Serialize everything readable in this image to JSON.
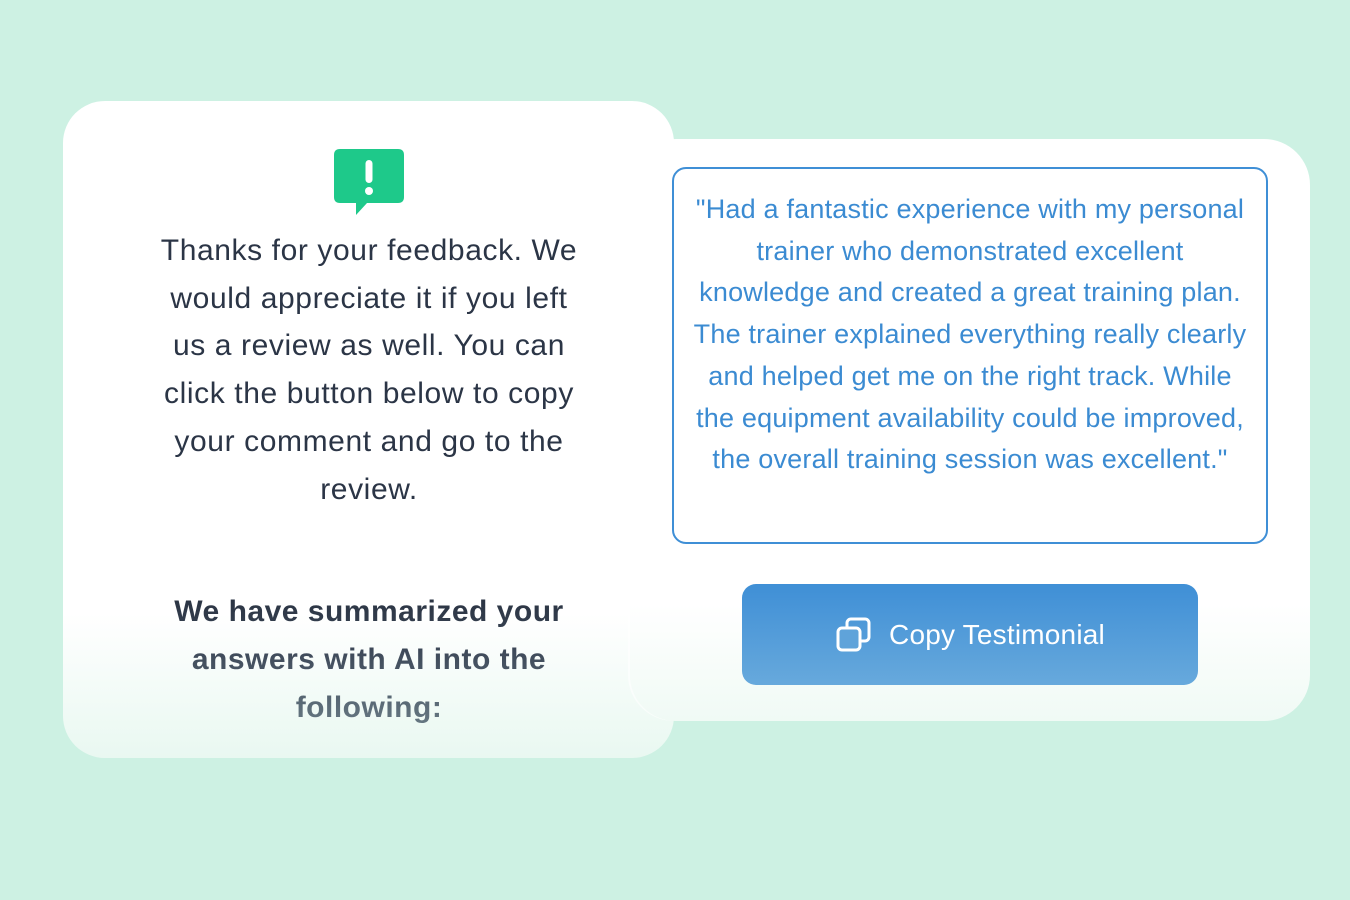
{
  "feedback_card": {
    "icon": "alert-chat-icon",
    "icon_color": "#1ec98a",
    "message": "Thanks for your feedback. We would appreciate it if you left us a review as well. You can click the button below to copy your comment and go to the review.",
    "summary_heading": "We have summarized your answers with AI into the following:"
  },
  "testimonial_card": {
    "quote": "\"Had a fantastic experience with my personal trainer who demonstrated excellent knowledge and created a great training plan. The trainer explained everything really clearly and helped get me on the right track. While the equipment availability could be improved, the overall training session was excellent.\"",
    "copy_button": {
      "label": "Copy Testimonial",
      "icon": "copy-icon"
    },
    "accent_color": "#3f8fd6"
  },
  "colors": {
    "background": "#cdf1e3",
    "text_dark": "#2b3546"
  }
}
